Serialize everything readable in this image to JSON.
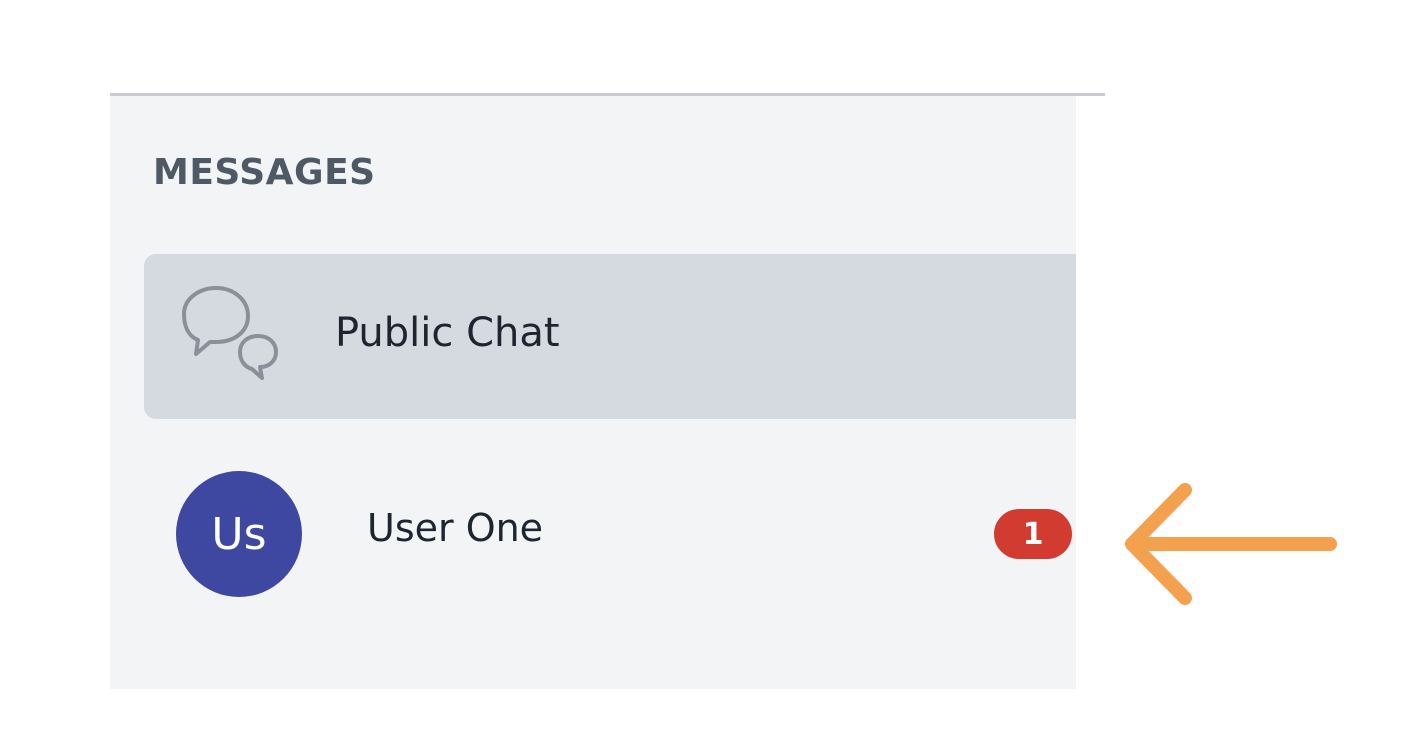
{
  "messages": {
    "title": "MESSAGES",
    "public_chat": {
      "label": "Public Chat",
      "icon": "chat-bubbles-icon"
    },
    "user_one": {
      "avatar_initials": "Us",
      "label": "User One",
      "unread_count": "1"
    }
  },
  "annotation": {
    "icon": "arrow-left-icon"
  },
  "colors": {
    "panel_bg": "#f3f4f6",
    "selected_bg": "#d5d9e0",
    "avatar_bg": "#3f48a1",
    "badge_bg": "#d23b30",
    "arrow": "#f3a04f",
    "title_text": "#4f5965"
  }
}
